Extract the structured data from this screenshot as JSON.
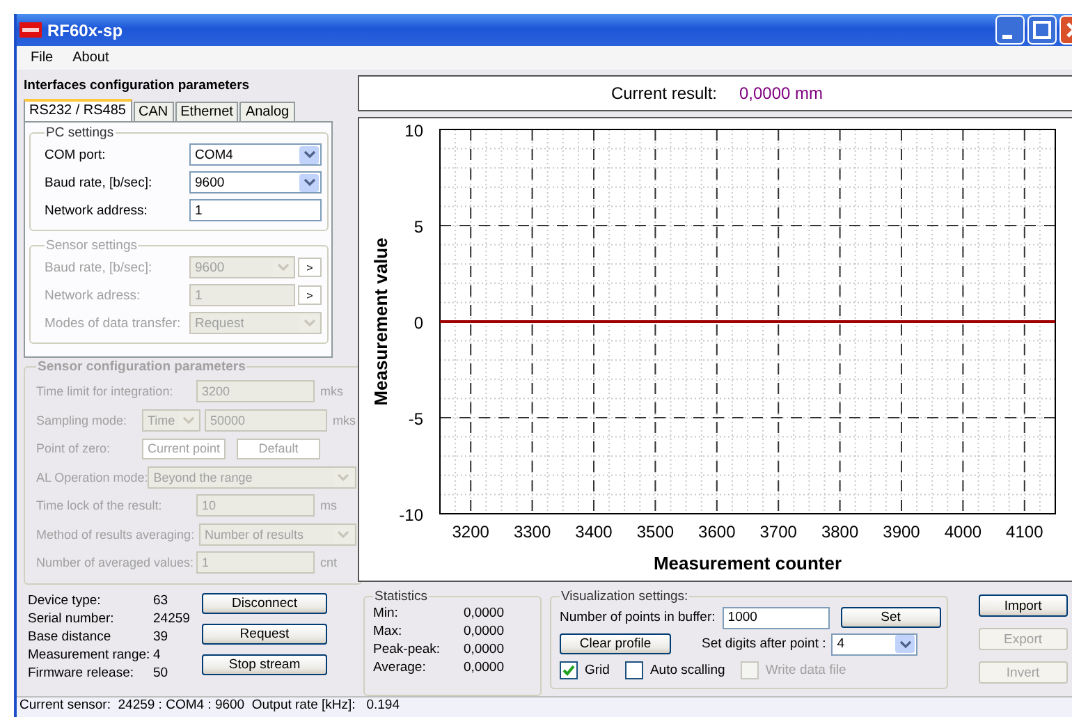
{
  "window": {
    "title": "RF60x-sp"
  },
  "menu": [
    "File",
    "About"
  ],
  "interfaces": {
    "title": "Interfaces configuration parameters",
    "tabs": [
      {
        "label": "RS232 / RS485",
        "selected": true
      },
      {
        "label": "CAN",
        "selected": false
      },
      {
        "label": "Ethernet",
        "selected": false
      },
      {
        "label": "Analog",
        "selected": false
      }
    ],
    "pc_settings": {
      "title": "PC settings",
      "disabled": false,
      "fields": [
        {
          "label": "COM port:",
          "kind": "select",
          "value": "COM4"
        },
        {
          "label": "Baud rate, [b/sec]:",
          "kind": "select",
          "value": "9600"
        },
        {
          "label": "Network address:",
          "kind": "input",
          "value": "1"
        }
      ]
    },
    "sensor_settings": {
      "title": "Sensor settings",
      "disabled": true,
      "fields": [
        {
          "label": "Baud rate, [b/sec]:",
          "kind": "select",
          "value": "9600",
          "action": ">"
        },
        {
          "label": "Network adress:",
          "kind": "input",
          "value": "1",
          "action": ">"
        },
        {
          "label": "Modes of data transfer:",
          "kind": "select",
          "value": "Request"
        }
      ]
    }
  },
  "sensor_config": {
    "title": "Sensor configuration parameters",
    "disabled": true,
    "rows": [
      {
        "label": "Time limit for integration:",
        "kind": "input",
        "value": "3200",
        "unit": "mks"
      },
      {
        "label": "Sampling mode:",
        "kind": "select_input",
        "option": "Time",
        "value": "50000",
        "unit": "mks"
      },
      {
        "label": "Point of zero:",
        "kind": "buttons",
        "buttons": [
          "Current point",
          "Default"
        ]
      },
      {
        "label": "AL Operation mode:",
        "kind": "wide_select",
        "value": "Beyond the range"
      },
      {
        "label": "Time lock of the result:",
        "kind": "input",
        "value": "10",
        "unit": "ms"
      },
      {
        "label": "Method of results averaging:",
        "kind": "select",
        "value": "Number of results"
      },
      {
        "label": "Number of averaged values:",
        "kind": "input",
        "value": "1",
        "unit": "cnt"
      }
    ]
  },
  "device_info": [
    {
      "label": "Device type:",
      "value": "63"
    },
    {
      "label": "Serial number:",
      "value": "24259"
    },
    {
      "label": "Base distance",
      "value": "39"
    },
    {
      "label": "Measurement range:",
      "value": "4"
    },
    {
      "label": "Firmware release:",
      "value": "50"
    }
  ],
  "device_buttons": [
    "Disconnect",
    "Request",
    "Stop stream"
  ],
  "current_result": {
    "label": "Current result:",
    "value": "0,0000 mm"
  },
  "chart": {
    "chart_data": {
      "type": "line",
      "grid": true,
      "xlabel": "Measurement counter",
      "ylabel": "Measurement value",
      "xlim": [
        3150,
        4150
      ],
      "ylim": [
        -10,
        10
      ],
      "xticks": [
        3200,
        3300,
        3400,
        3500,
        3600,
        3700,
        3800,
        3900,
        4000,
        4100
      ],
      "yticks": [
        -10,
        -5,
        0,
        5,
        10
      ],
      "x": [
        3150,
        4150
      ],
      "series": [
        {
          "color": "#a00000",
          "values": [
            0,
            0
          ]
        }
      ]
    }
  },
  "statistics": {
    "title": "Statistics",
    "rows": [
      {
        "label": "Min:",
        "value": "0,0000"
      },
      {
        "label": "Max:",
        "value": "0,0000"
      },
      {
        "label": "Peak-peak:",
        "value": "0,0000"
      },
      {
        "label": "Average:",
        "value": "0,0000"
      }
    ]
  },
  "visualization": {
    "title": "Visualization settings:",
    "buffer_label": "Number of points in buffer:",
    "buffer_value": "1000",
    "set_button": "Set",
    "clear_button": "Clear profile",
    "digits_label": "Set digits after point :",
    "digits_value": "4",
    "checkboxes": [
      {
        "label": "Grid",
        "checked": true,
        "disabled": false
      },
      {
        "label": "Auto scalling",
        "checked": false,
        "disabled": false
      },
      {
        "label": "Write data file",
        "checked": false,
        "disabled": true
      }
    ]
  },
  "side_buttons": [
    {
      "label": "Import",
      "disabled": false
    },
    {
      "label": "Export",
      "disabled": true
    },
    {
      "label": "Invert",
      "disabled": true
    }
  ],
  "status_bar": "Current sensor:  24259 : COM4 : 9600  Output rate [kHz]:   0.194"
}
